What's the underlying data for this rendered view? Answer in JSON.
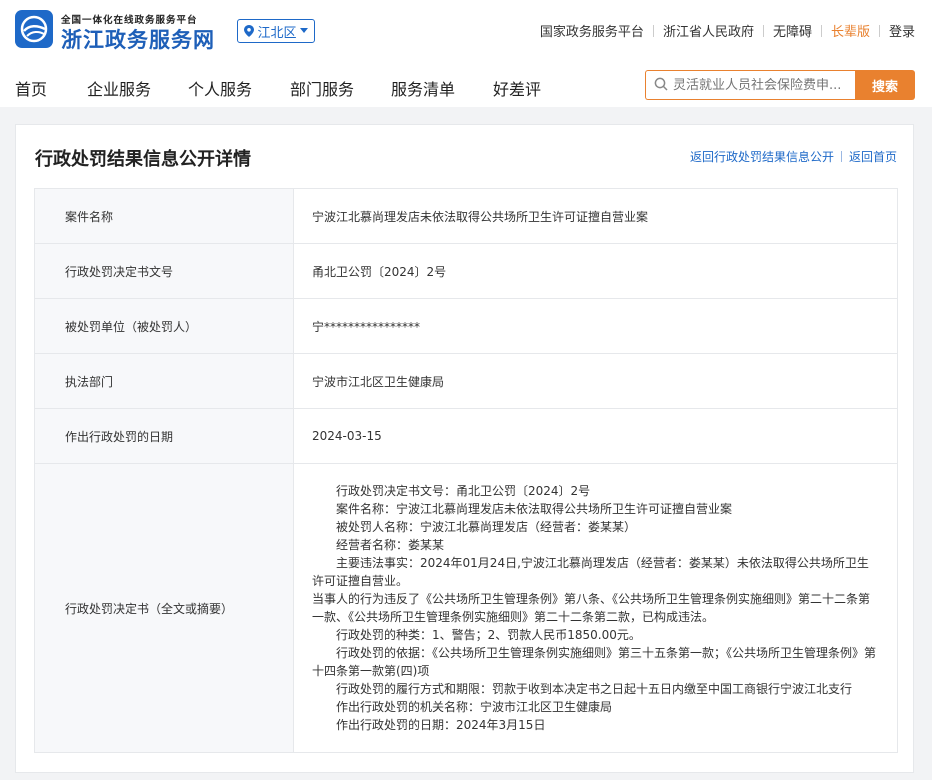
{
  "header": {
    "logo_subtitle": "全国一体化在线政务服务平台",
    "logo_title": "浙江政务服务网",
    "region": "江北区",
    "top_links": [
      {
        "label": "国家政务服务平台"
      },
      {
        "label": "浙江省人民政府"
      },
      {
        "label": "无障碍"
      },
      {
        "label": "长辈版"
      },
      {
        "label": "登录"
      }
    ]
  },
  "nav": {
    "items": [
      {
        "label": "首页"
      },
      {
        "label": "企业服务"
      },
      {
        "label": "个人服务"
      },
      {
        "label": "部门服务"
      },
      {
        "label": "服务清单"
      },
      {
        "label": "好差评"
      }
    ],
    "search": {
      "placeholder": "灵活就业人员社会保险费申...",
      "button": "搜索"
    }
  },
  "page": {
    "title": "行政处罚结果信息公开详情",
    "links": {
      "back_list": "返回行政处罚结果信息公开",
      "back_home": "返回首页"
    }
  },
  "record": {
    "rows": [
      {
        "label": "案件名称",
        "value": "宁波江北慕尚理发店未依法取得公共场所卫生许可证擅自营业案"
      },
      {
        "label": "行政处罚决定书文号",
        "value": "甬北卫公罚〔2024〕2号"
      },
      {
        "label": "被处罚单位（被处罚人）",
        "value": "宁****************"
      },
      {
        "label": "执法部门",
        "value": "宁波市江北区卫生健康局"
      },
      {
        "label": "作出行政处罚的日期",
        "value": "2024-03-15"
      }
    ],
    "decision_label": "行政处罚决定书（全文或摘要）",
    "decision_lines": [
      "行政处罚决定书文号：甬北卫公罚〔2024〕2号",
      "案件名称：宁波江北慕尚理发店未依法取得公共场所卫生许可证擅自营业案",
      "被处罚人名称：宁波江北慕尚理发店（经营者：娄某某）",
      "经营者名称：娄某某",
      "主要违法事实：2024年01月24日,宁波江北慕尚理发店（经营者：娄某某）未依法取得公共场所卫生许可证擅自营业。",
      "当事人的行为违反了《公共场所卫生管理条例》第八条、《公共场所卫生管理条例实施细则》第二十二条第一款、《公共场所卫生管理条例实施细则》第二十二条第二款，已构成违法。",
      "行政处罚的种类：1、警告；2、罚款人民币1850.00元。",
      "行政处罚的依据：《公共场所卫生管理条例实施细则》第三十五条第一款；《公共场所卫生管理条例》第十四条第一款第(四)项",
      "行政处罚的履行方式和期限：罚款于收到本决定书之日起十五日内缴至中国工商银行宁波江北支行",
      "作出行政处罚的机关名称：宁波市江北区卫生健康局",
      "作出行政处罚的日期：2024年3月15日"
    ]
  }
}
